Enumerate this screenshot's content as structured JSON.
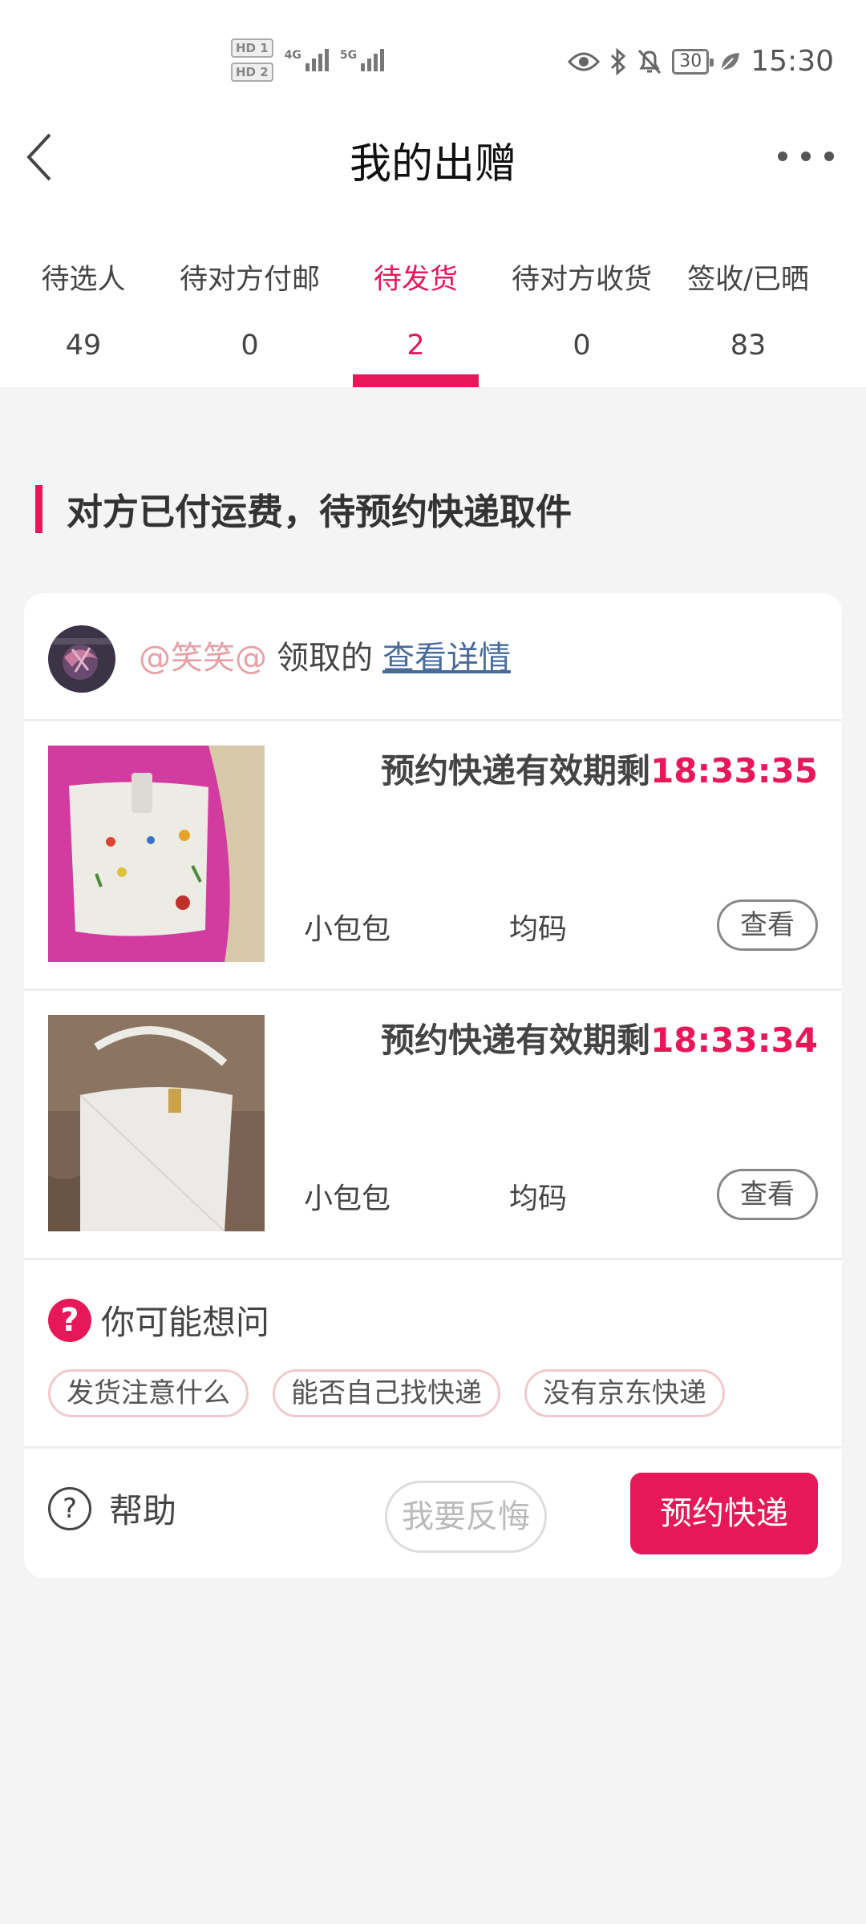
{
  "status_bar": {
    "hd1": "HD 1",
    "hd2": "HD 2",
    "net1": "4G",
    "net2": "5G",
    "battery": "30",
    "time": "15:30",
    "icons": [
      "eye-icon",
      "bluetooth-icon",
      "bell-off-icon",
      "battery-icon",
      "leaf-icon"
    ]
  },
  "header": {
    "title": "我的出赠",
    "back_icon": "chevron-left-icon",
    "more_icon": "more-dots-icon"
  },
  "tabs": [
    {
      "label": "待选人",
      "count": "49",
      "active": false
    },
    {
      "label": "待对方付邮",
      "count": "0",
      "active": false
    },
    {
      "label": "待发货",
      "count": "2",
      "active": true
    },
    {
      "label": "待对方收货",
      "count": "0",
      "active": false
    },
    {
      "label": "签收/已晒",
      "count": "83",
      "active": false
    }
  ],
  "section": {
    "title": "对方已付运费，待预约快递取件"
  },
  "card": {
    "user": {
      "name": "@笑笑@",
      "verb": "领取的",
      "link": "查看详情"
    },
    "items": [
      {
        "timer_label": "预约快递有效期剩",
        "timer_value": "18:33:35",
        "name": "小包包",
        "size": "均码",
        "view_label": "查看"
      },
      {
        "timer_label": "预约快递有效期剩",
        "timer_value": "18:33:34",
        "name": "小包包",
        "size": "均码",
        "view_label": "查看"
      }
    ],
    "faq": {
      "icon": "?",
      "title": "你可能想问",
      "chips": [
        "发货注意什么",
        "能否自己找快递",
        "没有京东快递"
      ]
    },
    "actions": {
      "help_icon": "?",
      "help_label": "帮助",
      "regret_label": "我要反悔",
      "book_label": "预约快递"
    }
  },
  "colors": {
    "accent": "#e6185a",
    "background": "#f4f4f5",
    "chip_border": "#f1c9cf"
  }
}
